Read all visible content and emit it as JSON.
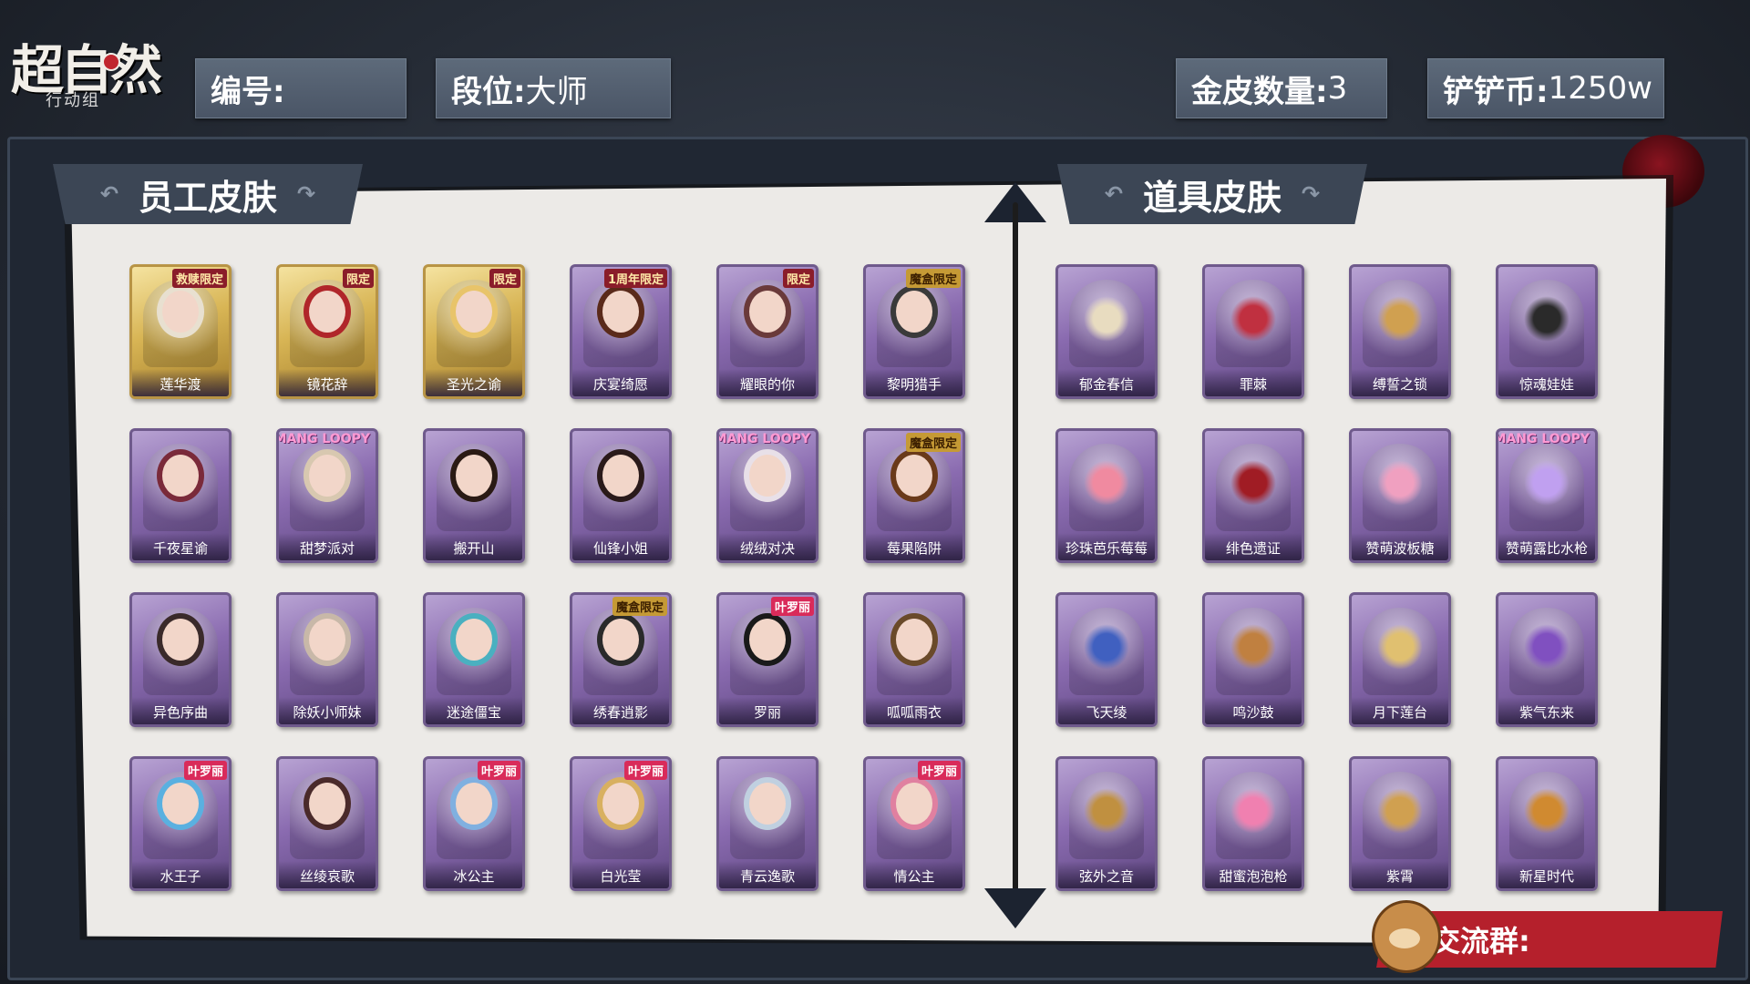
{
  "header": {
    "logo_title": "超自然",
    "logo_subtitle": "行动组",
    "id_label": "编号:",
    "id_value": "",
    "rank_label": "段位:",
    "rank_value": "大师",
    "gold_skin_label": "金皮数量:",
    "gold_skin_value": "3",
    "coin_label": "铲铲币:",
    "coin_value": "1250w"
  },
  "sections": {
    "staff_title": "员工皮肤",
    "item_title": "道具皮肤"
  },
  "staff_skins": [
    {
      "name": "莲华渡",
      "badge": "救赎限定",
      "rarity": "gold",
      "hair": "#e8e0d0"
    },
    {
      "name": "镜花辞",
      "badge": "限定",
      "rarity": "gold",
      "hair": "#b0262a"
    },
    {
      "name": "圣光之谕",
      "badge": "限定",
      "rarity": "gold",
      "hair": "#e8c46a"
    },
    {
      "name": "庆宴绮愿",
      "badge": "1周年限定",
      "rarity": "purple",
      "hair": "#5a2a1a"
    },
    {
      "name": "耀眼的你",
      "badge": "限定",
      "rarity": "purple",
      "hair": "#6a3a3a"
    },
    {
      "name": "黎明猎手",
      "badge": "魔盒限定",
      "rarity": "purple",
      "hair": "#3a3a3a"
    },
    {
      "name": "千夜星谕",
      "badge": "",
      "rarity": "purple",
      "hair": "#7a2a3a"
    },
    {
      "name": "甜梦派对",
      "badge": "ZANMANG LOOPY",
      "rarity": "purple",
      "hair": "#d8c8b0"
    },
    {
      "name": "搬开山",
      "badge": "",
      "rarity": "purple",
      "hair": "#2a1a14"
    },
    {
      "name": "仙锋小姐",
      "badge": "",
      "rarity": "purple",
      "hair": "#2a1a1a"
    },
    {
      "name": "绒绒对决",
      "badge": "ZANMANG LOOPY",
      "rarity": "purple",
      "hair": "#e8e0e8"
    },
    {
      "name": "莓果陷阱",
      "badge": "魔盒限定",
      "rarity": "purple",
      "hair": "#6a3a1a"
    },
    {
      "name": "异色序曲",
      "badge": "",
      "rarity": "purple",
      "hair": "#3a2a2a"
    },
    {
      "name": "除妖小师妹",
      "badge": "",
      "rarity": "purple",
      "hair": "#c8b8a8"
    },
    {
      "name": "迷途僵宝",
      "badge": "",
      "rarity": "purple",
      "hair": "#4ab0c0"
    },
    {
      "name": "绣春逍影",
      "badge": "魔盒限定",
      "rarity": "purple",
      "hair": "#2a2a2a"
    },
    {
      "name": "罗丽",
      "badge": "叶罗丽",
      "rarity": "purple",
      "hair": "#1a1a1a"
    },
    {
      "name": "呱呱雨衣",
      "badge": "",
      "rarity": "purple",
      "hair": "#6a4a2a"
    },
    {
      "name": "水王子",
      "badge": "叶罗丽",
      "rarity": "purple",
      "hair": "#5ab0e0"
    },
    {
      "name": "丝绫哀歌",
      "badge": "",
      "rarity": "purple",
      "hair": "#4a2a2a"
    },
    {
      "name": "冰公主",
      "badge": "叶罗丽",
      "rarity": "purple",
      "hair": "#80b0e0"
    },
    {
      "name": "白光莹",
      "badge": "叶罗丽",
      "rarity": "purple",
      "hair": "#d8b060"
    },
    {
      "name": "青云逸歌",
      "badge": "",
      "rarity": "purple",
      "hair": "#c0d0e0"
    },
    {
      "name": "情公主",
      "badge": "叶罗丽",
      "rarity": "purple",
      "hair": "#e080a0"
    }
  ],
  "item_skins": [
    {
      "name": "郁金春信",
      "badge": "",
      "color": "#e8dcc0"
    },
    {
      "name": "罪棘",
      "badge": "",
      "color": "#c03040"
    },
    {
      "name": "缚誓之锁",
      "badge": "",
      "color": "#d0a050"
    },
    {
      "name": "惊魂娃娃",
      "badge": "",
      "color": "#2a2a2a"
    },
    {
      "name": "珍珠芭乐莓莓",
      "badge": "",
      "color": "#f08aa0"
    },
    {
      "name": "绯色遗证",
      "badge": "",
      "color": "#a01c24"
    },
    {
      "name": "赞萌波板糖",
      "badge": "",
      "color": "#f0a0c0"
    },
    {
      "name": "赞萌露比水枪",
      "badge": "ZANMANG LOOPY",
      "color": "#c0a0f0"
    },
    {
      "name": "飞天绫",
      "badge": "",
      "color": "#4060c0"
    },
    {
      "name": "鸣沙鼓",
      "badge": "",
      "color": "#c08040"
    },
    {
      "name": "月下莲台",
      "badge": "",
      "color": "#e0c070"
    },
    {
      "name": "紫气东来",
      "badge": "",
      "color": "#8050c0"
    },
    {
      "name": "弦外之音",
      "badge": "",
      "color": "#c09040"
    },
    {
      "name": "甜蜜泡泡枪",
      "badge": "",
      "color": "#f080b0"
    },
    {
      "name": "紫霄",
      "badge": "",
      "color": "#d0a050"
    },
    {
      "name": "新星时代",
      "badge": "",
      "color": "#d08a30"
    }
  ],
  "footer": {
    "group_label": "交流群:"
  }
}
